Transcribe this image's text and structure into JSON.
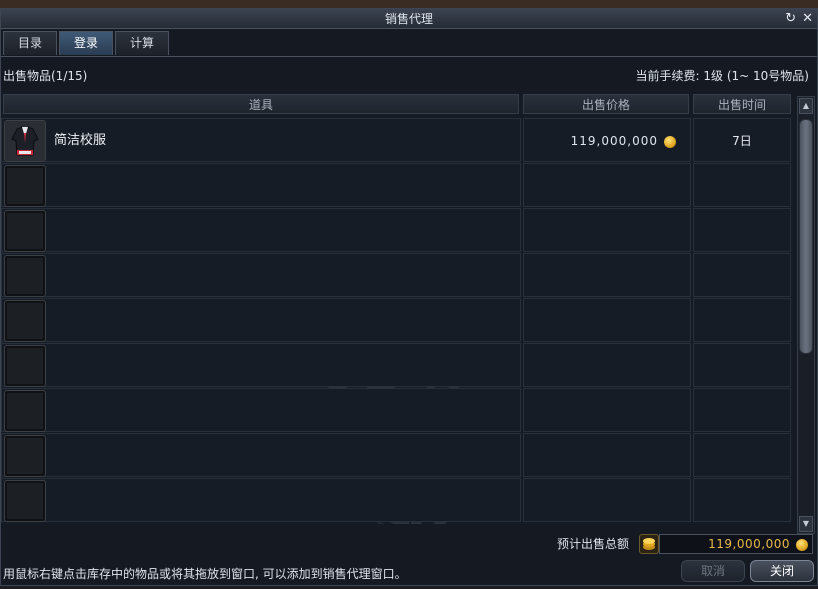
{
  "window": {
    "title": "销售代理",
    "controls": {
      "restore_icon": "↻",
      "close_icon": "✕"
    }
  },
  "tabs": [
    {
      "label": "目录",
      "active": false
    },
    {
      "label": "登录",
      "active": true
    },
    {
      "label": "计算",
      "active": false
    }
  ],
  "info": {
    "items_count": "出售物品(1/15)",
    "fee": "当前手续费: 1级 (1~ 10号物品)"
  },
  "table": {
    "headers": {
      "item": "道具",
      "price": "出售价格",
      "time": "出售时间"
    },
    "rows": [
      {
        "name": "简洁校服",
        "price": "119,000,000",
        "time": "7日",
        "filled": true
      },
      {
        "name": "",
        "price": "",
        "time": "",
        "filled": false
      },
      {
        "name": "",
        "price": "",
        "time": "",
        "filled": false
      },
      {
        "name": "",
        "price": "",
        "time": "",
        "filled": false
      },
      {
        "name": "",
        "price": "",
        "time": "",
        "filled": false
      },
      {
        "name": "",
        "price": "",
        "time": "",
        "filled": false
      },
      {
        "name": "",
        "price": "",
        "time": "",
        "filled": false
      },
      {
        "name": "",
        "price": "",
        "time": "",
        "filled": false
      },
      {
        "name": "",
        "price": "",
        "time": "",
        "filled": false
      }
    ]
  },
  "total": {
    "label": "预计出售总额",
    "value": "119,000,000"
  },
  "hint": "用鼠标右键点击库存中的物品或将其拖放到窗口, 可以添加到销售代理窗口。",
  "buttons": {
    "cancel": "取消",
    "close": "关闭"
  },
  "colors": {
    "accent_tab": "#3f5a76",
    "gold": "#e8b84a",
    "panel": "#141922"
  }
}
